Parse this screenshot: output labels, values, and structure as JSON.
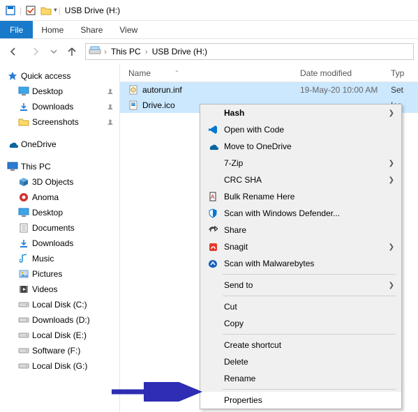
{
  "titlebar": {
    "title": "USB Drive (H:)"
  },
  "ribbon": {
    "file": "File",
    "tabs": [
      "Home",
      "Share",
      "View"
    ]
  },
  "breadcrumbs": {
    "root": "This PC",
    "leaf": "USB Drive (H:)"
  },
  "columns": {
    "name": "Name",
    "date": "Date modified",
    "type": "Typ"
  },
  "files": [
    {
      "name": "autorun.inf",
      "date": "19-May-20  10:00 AM",
      "type": "Set"
    },
    {
      "name": "Drive.ico",
      "date": "",
      "type": "Ico"
    }
  ],
  "tree": {
    "quick_access": "Quick access",
    "quick_items": [
      {
        "label": "Desktop",
        "icon": "desktop"
      },
      {
        "label": "Downloads",
        "icon": "downloads"
      },
      {
        "label": "Screenshots",
        "icon": "folder"
      }
    ],
    "onedrive": "OneDrive",
    "this_pc": "This PC",
    "pc_items": [
      {
        "label": "3D Objects",
        "icon": "3d"
      },
      {
        "label": "Anoma",
        "icon": "anoma"
      },
      {
        "label": "Desktop",
        "icon": "desktop"
      },
      {
        "label": "Documents",
        "icon": "documents"
      },
      {
        "label": "Downloads",
        "icon": "downloads"
      },
      {
        "label": "Music",
        "icon": "music"
      },
      {
        "label": "Pictures",
        "icon": "pictures"
      },
      {
        "label": "Videos",
        "icon": "videos"
      },
      {
        "label": "Local Disk (C:)",
        "icon": "disk"
      },
      {
        "label": "Downloads  (D:)",
        "icon": "disk"
      },
      {
        "label": "Local Disk (E:)",
        "icon": "disk"
      },
      {
        "label": "Software  (F:)",
        "icon": "disk"
      },
      {
        "label": "Local Disk (G:)",
        "icon": "disk"
      }
    ]
  },
  "context_menu": {
    "groups": [
      [
        {
          "label": "Hash",
          "icon": "",
          "submenu": true,
          "bold": true
        },
        {
          "label": "Open with Code",
          "icon": "vscode"
        },
        {
          "label": "Move to OneDrive",
          "icon": "onedrive"
        },
        {
          "label": "7-Zip",
          "icon": "",
          "submenu": true
        },
        {
          "label": "CRC SHA",
          "icon": "",
          "submenu": true
        },
        {
          "label": "Bulk Rename Here",
          "icon": "brh"
        },
        {
          "label": "Scan with Windows Defender...",
          "icon": "defender"
        },
        {
          "label": "Share",
          "icon": "share"
        },
        {
          "label": "Snagit",
          "icon": "snagit",
          "submenu": true
        },
        {
          "label": "Scan with Malwarebytes",
          "icon": "mwb"
        }
      ],
      [
        {
          "label": "Send to",
          "icon": "",
          "submenu": true
        }
      ],
      [
        {
          "label": "Cut",
          "icon": ""
        },
        {
          "label": "Copy",
          "icon": ""
        }
      ],
      [
        {
          "label": "Create shortcut",
          "icon": ""
        },
        {
          "label": "Delete",
          "icon": ""
        },
        {
          "label": "Rename",
          "icon": ""
        }
      ],
      [
        {
          "label": "Properties",
          "icon": "",
          "hover": true
        }
      ]
    ]
  }
}
